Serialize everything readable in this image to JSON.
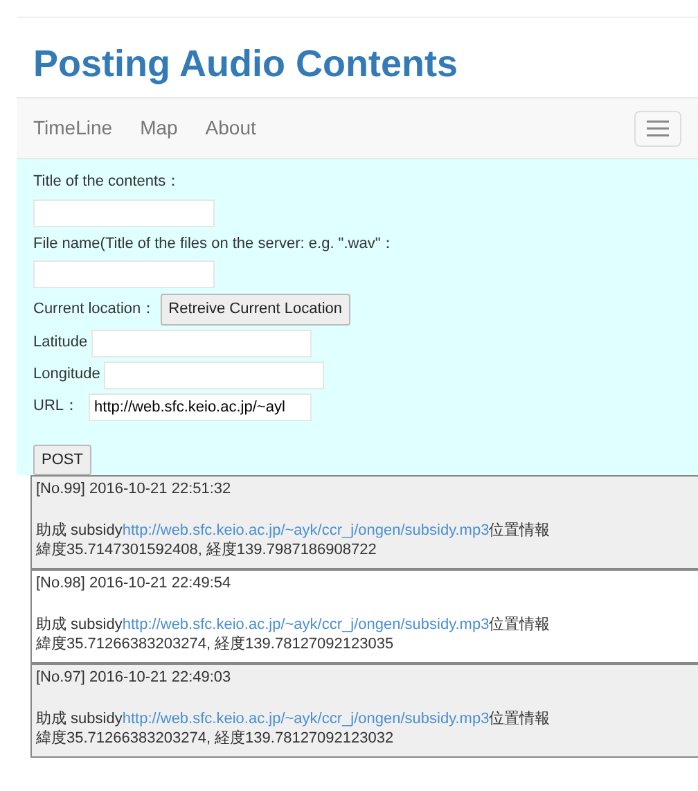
{
  "title": "Posting Audio Contents",
  "nav": [
    {
      "label": "TimeLine"
    },
    {
      "label": "Map"
    },
    {
      "label": "About"
    }
  ],
  "form": {
    "title_label": "Title of the contents：",
    "file_label": "File name(Title of the files on the server: e.g. \".wav\"：",
    "location_label": "Current location：",
    "location_button": "Retreive Current Location",
    "latitude_label": "Latitude",
    "longitude_label": "Longitude",
    "url_label": "URL：",
    "url_value": "http://web.sfc.keio.ac.jp/~ayl",
    "post_button": "POST"
  },
  "posts": [
    {
      "header": "[No.99] 2016-10-21 22:51:32",
      "text": "助成 subsidy",
      "link": "http://web.sfc.keio.ac.jp/~ayk/ccr_j/ongen/subsidy.mp3",
      "after": "位置情報",
      "coords": "緯度35.7147301592408, 経度139.7987186908722"
    },
    {
      "header": "[No.98] 2016-10-21 22:49:54",
      "text": "助成 subsidy",
      "link": "http://web.sfc.keio.ac.jp/~ayk/ccr_j/ongen/subsidy.mp3",
      "after": "位置情報",
      "coords": "緯度35.71266383203274, 経度139.78127092123035"
    },
    {
      "header": "[No.97] 2016-10-21 22:49:03",
      "text": "助成 subsidy",
      "link": "http://web.sfc.keio.ac.jp/~ayk/ccr_j/ongen/subsidy.mp3",
      "after": "位置情報",
      "coords": "緯度35.71266383203274, 経度139.78127092123032"
    }
  ]
}
